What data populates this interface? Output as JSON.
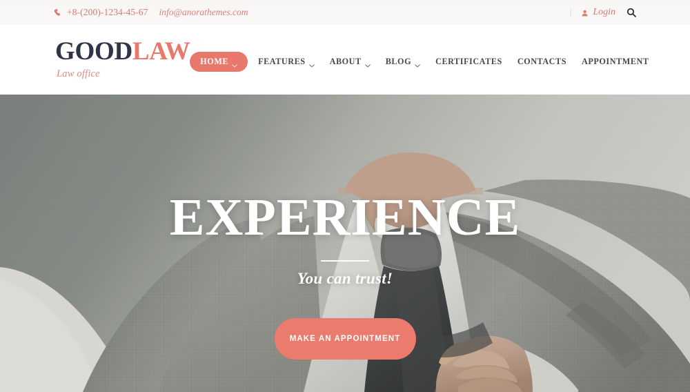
{
  "topbar": {
    "phone_icon": "phone-icon",
    "phone": "+8-(200)-1234-45-67",
    "email": "info@anorathemes.com",
    "separator": "|",
    "user_icon": "user-icon",
    "login_label": "Login",
    "search_icon": "search-icon"
  },
  "header": {
    "logo": {
      "part_dark": "GOOD",
      "part_accent": "LAW",
      "tagline": "Law office"
    },
    "nav": [
      {
        "label": "HOME",
        "has_chevron": true,
        "active": true
      },
      {
        "label": "FEATURES",
        "has_chevron": true,
        "active": false
      },
      {
        "label": "ABOUT",
        "has_chevron": true,
        "active": false
      },
      {
        "label": "BLOG",
        "has_chevron": true,
        "active": false
      },
      {
        "label": "CERTIFICATES",
        "has_chevron": false,
        "active": false
      },
      {
        "label": "CONTACTS",
        "has_chevron": false,
        "active": false
      },
      {
        "label": "APPOINTMENT",
        "has_chevron": false,
        "active": false
      }
    ]
  },
  "hero": {
    "title": "EXPERIENCE",
    "subtitle": "You can trust!",
    "cta_label": "MAKE AN APPOINTMENT",
    "background_description": "Man in gray suit adjusting jacket, white shirt and dark tie"
  },
  "colors": {
    "accent": "#e8786c",
    "accent_button": "#eb7b6d",
    "logo_dark": "#2f3446",
    "nav_text": "#4b4745",
    "topbar_bg": "#f7f6f5",
    "hero_overlay_gray": "#8a8d88",
    "white": "#ffffff"
  }
}
